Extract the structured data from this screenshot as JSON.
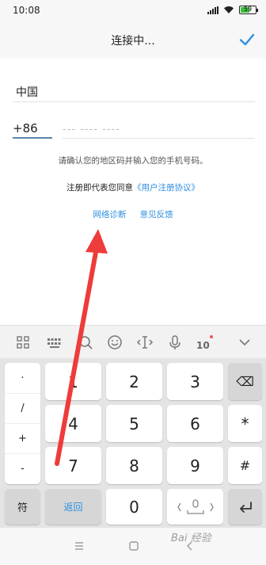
{
  "status": {
    "time": "10:08",
    "battery": "59",
    "battery_level": 0.59
  },
  "header": {
    "title": "连接中..."
  },
  "form": {
    "country": "中国",
    "country_code": "+86",
    "phone_placeholder": "--- ---- ----",
    "hint": "请确认您的地区码并输入您的手机号码。",
    "terms_prefix": "注册即代表您同意",
    "terms_link": "《用户注册协议》",
    "network_diag": "网络诊断",
    "feedback": "意见反馈"
  },
  "toolbar": {
    "icons": [
      "grid-icon",
      "keyboard-icon",
      "search-icon",
      "emoji-icon",
      "cursor-icon",
      "microphone-icon",
      "xiaomi-ime-icon",
      "collapse-icon"
    ],
    "ime_badge": "10"
  },
  "keyboard": {
    "symbols": [
      "·",
      "/",
      "+",
      "-"
    ],
    "digits": [
      "1",
      "2",
      "3",
      "4",
      "5",
      "6",
      "7",
      "8",
      "9",
      "0"
    ],
    "sym_label": "符",
    "return_label": "返回",
    "right_keys": [
      "⌫",
      "*",
      "#"
    ]
  },
  "watermark": "Bai 经验"
}
